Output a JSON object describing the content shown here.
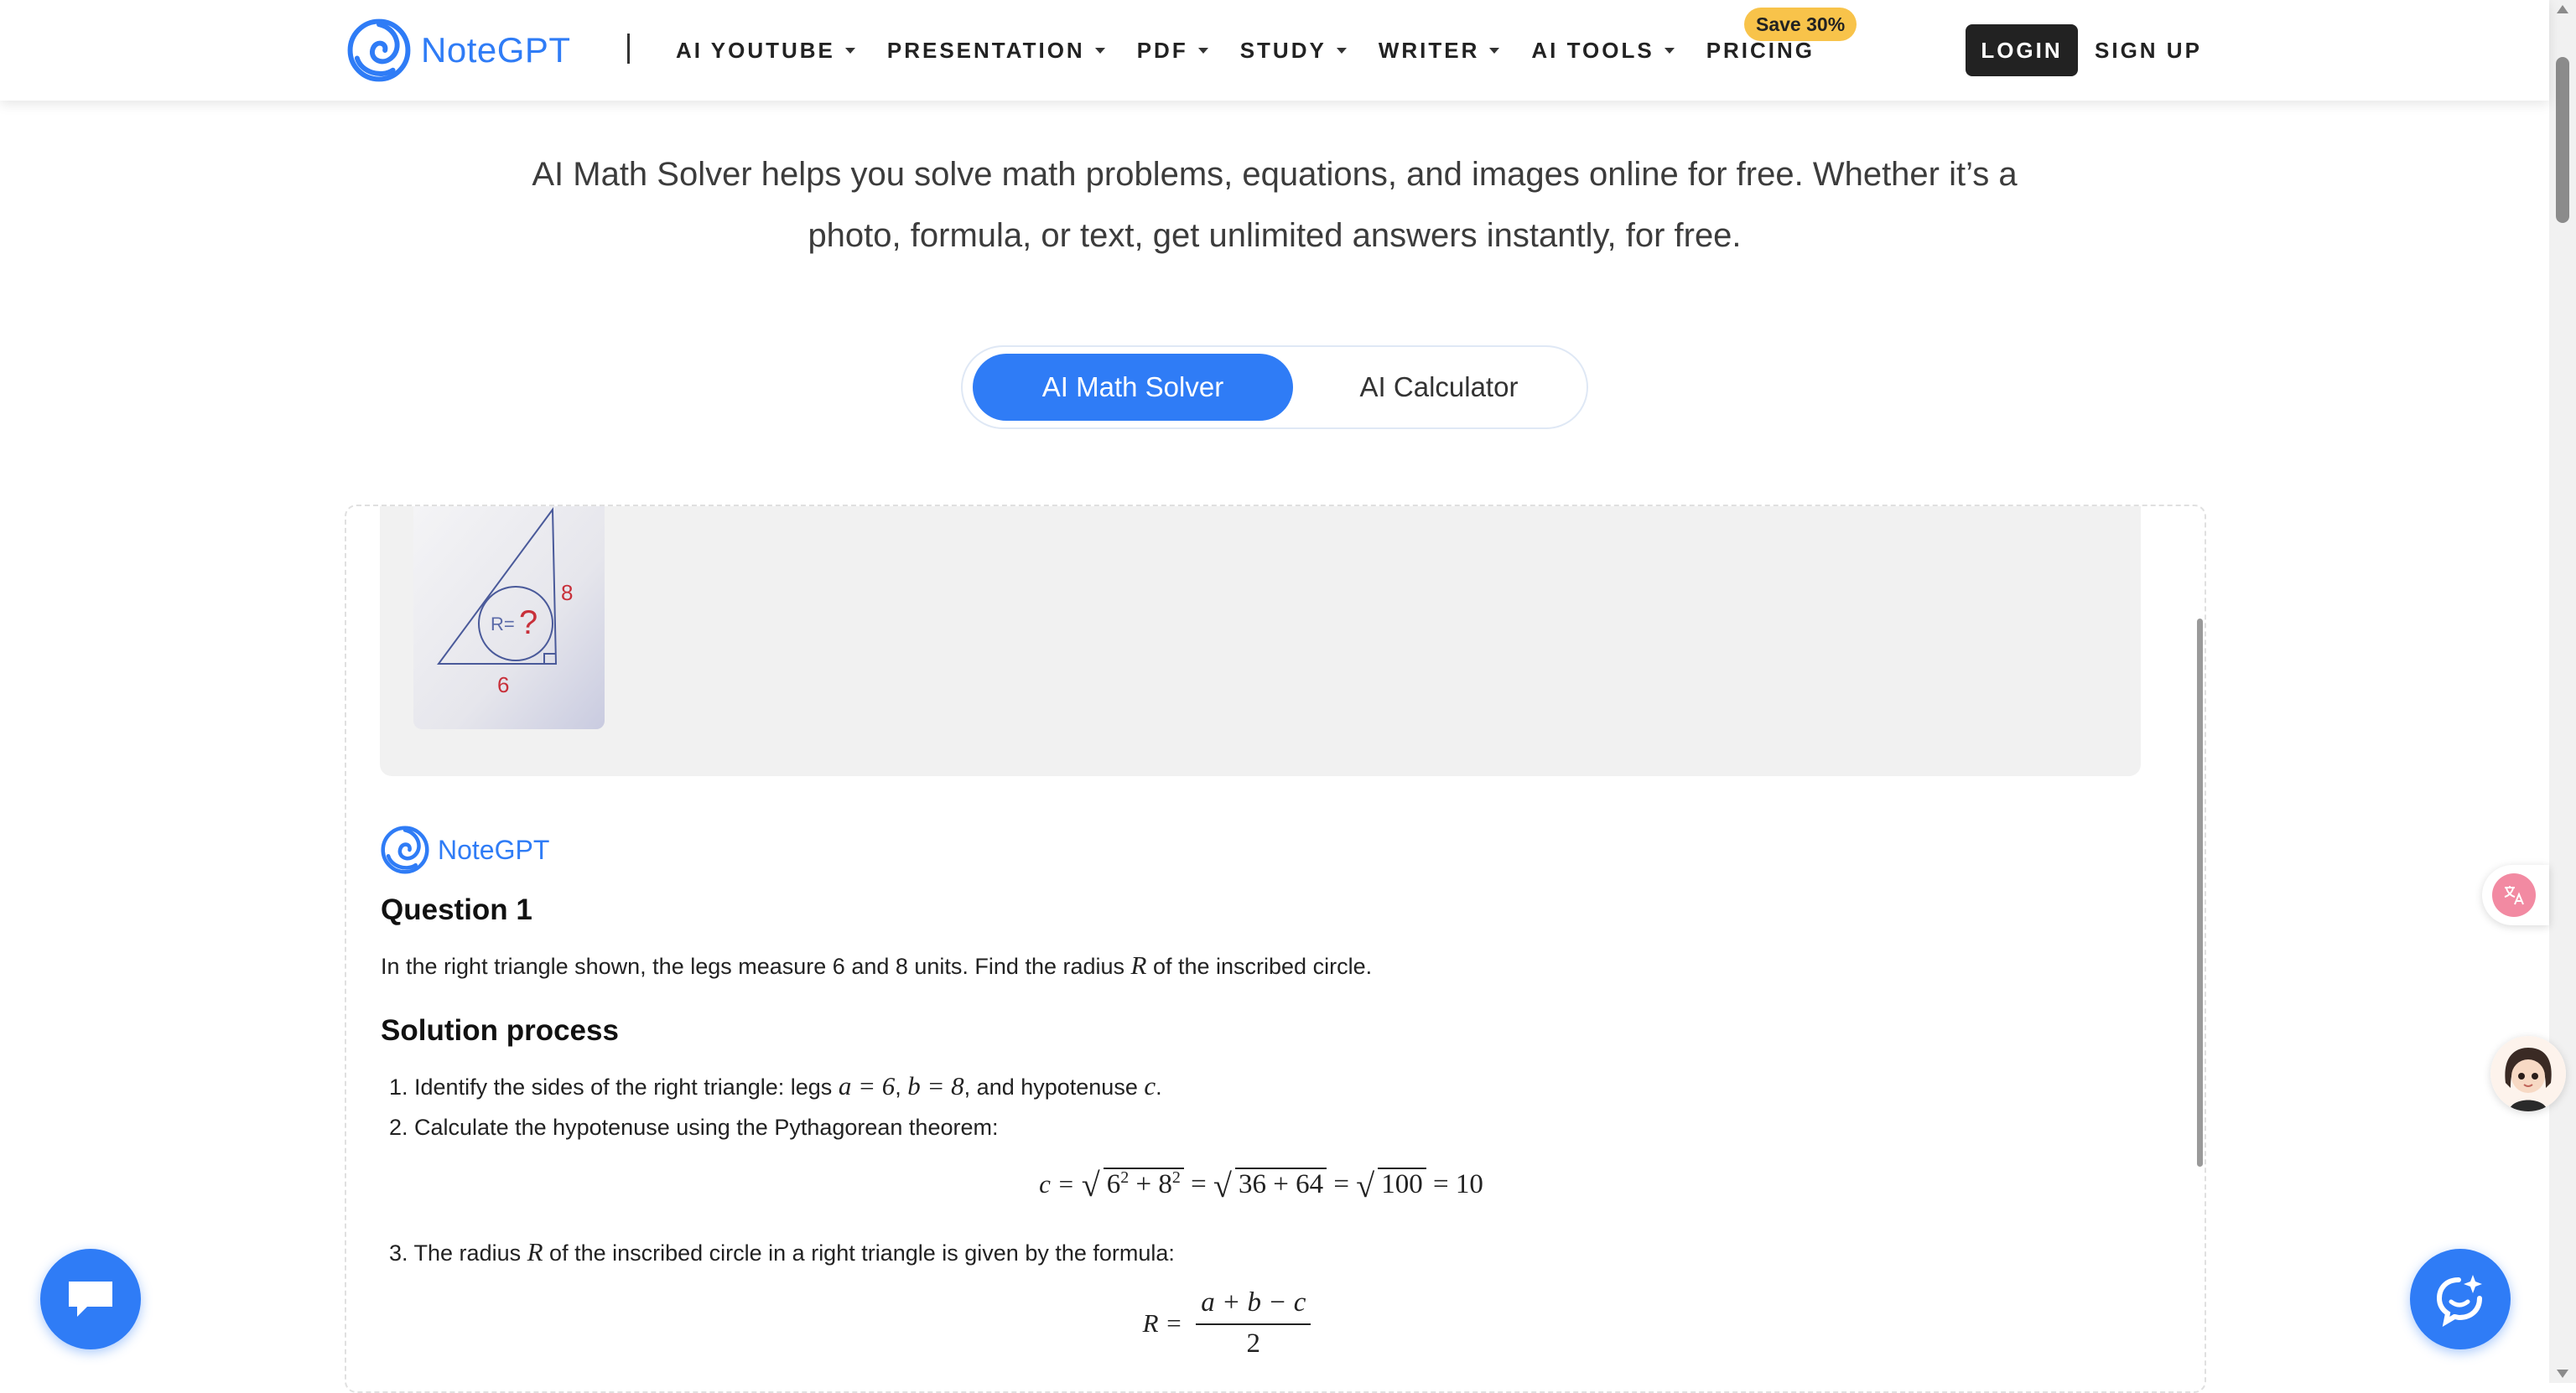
{
  "brand": {
    "name": "NoteGPT",
    "color": "#2f7cf6"
  },
  "nav": {
    "items": [
      {
        "label": "AI YOUTUBE",
        "dropdown": true
      },
      {
        "label": "PRESENTATION",
        "dropdown": true
      },
      {
        "label": "PDF",
        "dropdown": true
      },
      {
        "label": "STUDY",
        "dropdown": true
      },
      {
        "label": "WRITER",
        "dropdown": true
      },
      {
        "label": "AI TOOLS",
        "dropdown": true
      },
      {
        "label": "PRICING",
        "dropdown": false
      }
    ],
    "save_badge": "Save 30%",
    "login": "LOGIN",
    "signup": "SIGN UP"
  },
  "hero": {
    "subtitle_line1": "AI Math Solver helps you solve math problems, equations, and images online for free. Whether it’s a",
    "subtitle_line2": "photo, formula, or text, get unlimited answers instantly, for free."
  },
  "modes": {
    "active": "AI Math Solver",
    "inactive": "AI Calculator"
  },
  "user_upload": {
    "image_labels": {
      "r": "R=",
      "q": "?",
      "leg_a": "6",
      "leg_b": "8"
    }
  },
  "answer": {
    "author": "NoteGPT",
    "question_heading": "Question 1",
    "question_pre": "In the right triangle shown, the legs measure 6 and 8 units. Find the radius ",
    "question_var": "R",
    "question_post": " of the inscribed circle.",
    "solution_heading": "Solution process",
    "step1_pre": "1. Identify the sides of the right triangle: legs ",
    "step1_m1": "a = 6",
    "step1_m2": "b = 8",
    "step1_post": ", and hypotenuse ",
    "step1_var": "c",
    "step2": "2. Calculate the hypotenuse using the Pythagorean theorem:",
    "eq1": {
      "lhs": "c =",
      "sq1": "6",
      "sq1b": "8",
      "mid": "36 + 64",
      "r100": "100",
      "result": "= 10"
    },
    "step3_pre": "3. The radius ",
    "step3_var": "R",
    "step3_post": " of the inscribed circle in a right triangle is given by the formula:",
    "eq2": {
      "lhs": "R =",
      "num": "a + b − c",
      "den": "2"
    }
  },
  "colors": {
    "accent": "#2f7cf6",
    "badge": "#f8c34a",
    "login_bg": "#222222",
    "panel_bg": "#f1f1f1",
    "translate": "#f28aa2"
  },
  "icons": [
    "notegpt-logo-icon",
    "chat-bubble-icon",
    "ai-assistant-icon",
    "translate-icon",
    "avatar-icon"
  ]
}
